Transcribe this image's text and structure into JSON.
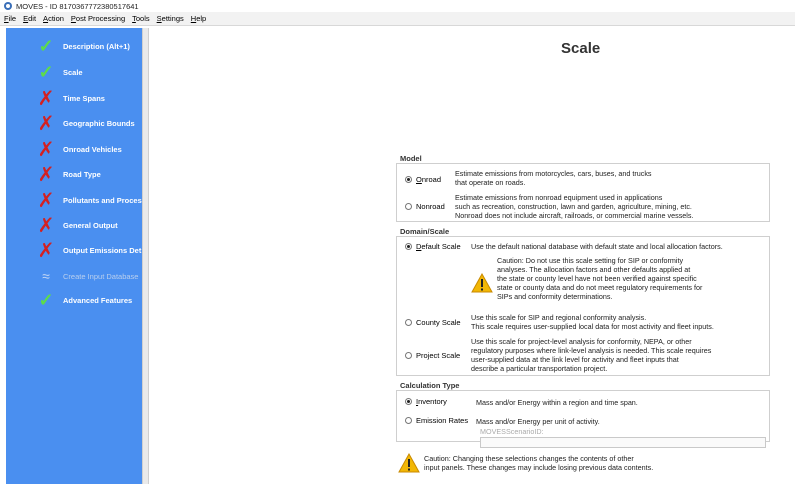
{
  "window": {
    "title": "MOVES - ID 8170367772380517641"
  },
  "menu": [
    {
      "label": "File",
      "u": "F",
      "rest": "ile"
    },
    {
      "label": "Edit",
      "u": "E",
      "rest": "dit"
    },
    {
      "label": "Action",
      "u": "A",
      "rest": "ction"
    },
    {
      "label": "Post Processing",
      "u": "P",
      "rest": "ost Processing"
    },
    {
      "label": "Tools",
      "u": "T",
      "rest": "ools"
    },
    {
      "label": "Settings",
      "u": "S",
      "rest": "ettings"
    },
    {
      "label": "Help",
      "u": "H",
      "rest": "elp"
    }
  ],
  "sidebar": {
    "items": [
      {
        "label": "Description (Alt+1)",
        "status": "check"
      },
      {
        "label": "Scale",
        "status": "check"
      },
      {
        "label": "Time Spans",
        "status": "cross"
      },
      {
        "label": "Geographic Bounds",
        "status": "cross"
      },
      {
        "label": "Onroad Vehicles",
        "status": "cross"
      },
      {
        "label": "Road Type",
        "status": "cross"
      },
      {
        "label": "Pollutants and Proces",
        "status": "cross"
      },
      {
        "label": "General Output",
        "status": "cross"
      },
      {
        "label": "Output Emissions Det",
        "status": "cross"
      },
      {
        "label": "Create Input Database",
        "status": "disabled"
      },
      {
        "label": "Advanced Features",
        "status": "check"
      }
    ]
  },
  "main": {
    "title": "Scale",
    "model": {
      "title": "Model",
      "onroad": {
        "label": "Onroad",
        "u": "O",
        "rest": "nroad",
        "selected": true,
        "desc": [
          "Estimate emissions from motorcycles, cars, buses, and trucks",
          "that operate on roads."
        ]
      },
      "nonroad": {
        "label": "Nonroad",
        "selected": false,
        "desc": [
          "Estimate emissions from nonroad equipment used in applications",
          "such as recreation, construction, lawn and garden, agriculture, mining, etc.",
          "Nonroad does not include aircraft, railroads, or commercial marine vessels."
        ]
      }
    },
    "domain": {
      "title": "Domain/Scale",
      "default": {
        "label": "Default Scale",
        "u": "D",
        "rest": "efault Scale",
        "selected": true,
        "desc": "Use the default national database with default state and local allocation factors."
      },
      "caution": [
        "Caution: Do not use this scale setting for SIP or conformity",
        "analyses. The allocation factors and other defaults applied at",
        "the state or county level have not been verified against specific",
        "state or county data and do not meet regulatory requirements for",
        "SIPs and conformity determinations."
      ],
      "county": {
        "label": "County Scale",
        "selected": false,
        "desc": [
          "Use this scale for SIP and regional conformity analysis.",
          "This scale requires user-supplied local data for most activity and fleet inputs."
        ]
      },
      "project": {
        "label": "Project Scale",
        "selected": false,
        "desc": [
          "Use this scale for project-level analysis for conformity, NEPA, or other",
          "regulatory purposes where link-level analysis is needed. This scale requires",
          "user-supplied data at the link level for activity and fleet inputs that",
          "describe a particular transportation project."
        ]
      }
    },
    "calc": {
      "title": "Calculation Type",
      "inventory": {
        "label": "Inventory",
        "u": "I",
        "rest": "nventory",
        "selected": true,
        "desc": "Mass and/or Energy within a region and time span."
      },
      "rates": {
        "label": "Emission Rates",
        "selected": false,
        "desc": "Mass and/or Energy per unit of activity."
      },
      "scenario_label": "MOVESScenarioID:",
      "scenario_value": ""
    },
    "bottom_caution": [
      "Caution: Changing these selections changes the contents of other",
      "input panels. These changes may include losing previous data contents."
    ]
  },
  "colors": {
    "sidebar_bg": "#4a8ff0",
    "check": "#5ddc4b",
    "cross": "#d42020"
  }
}
